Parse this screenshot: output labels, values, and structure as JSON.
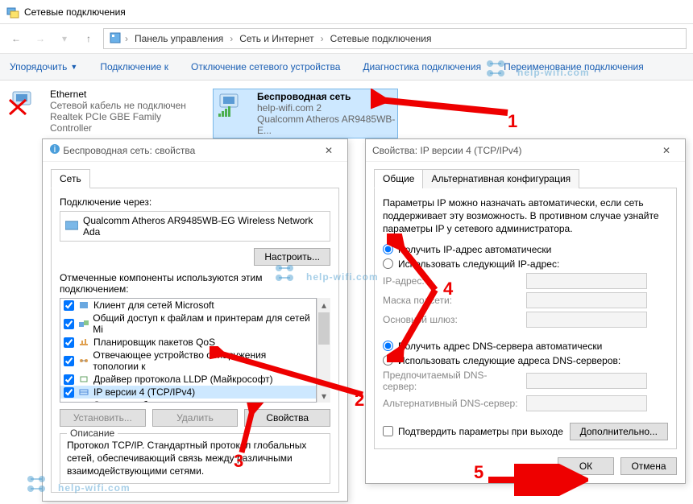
{
  "window": {
    "title": "Сетевые подключения"
  },
  "breadcrumb": {
    "p1": "Панель управления",
    "p2": "Сеть и Интернет",
    "p3": "Сетевые подключения"
  },
  "toolbar": {
    "organize": "Упорядочить",
    "connect": "Подключение к",
    "disable": "Отключение сетевого устройства",
    "diag": "Диагностика подключения",
    "rename": "Переименование подключения"
  },
  "net": {
    "eth": {
      "name": "Ethernet",
      "status": "Сетевой кабель не подключен",
      "device": "Realtek PCIe GBE Family Controller"
    },
    "wifi": {
      "name": "Беспроводная сеть",
      "status": "help-wifi.com  2",
      "device": "Qualcomm Atheros AR9485WB-E..."
    }
  },
  "dlg1": {
    "title": "Беспроводная сеть: свойства",
    "tab_net": "Сеть",
    "connect_via": "Подключение через:",
    "adapter": "Qualcomm Atheros AR9485WB-EG Wireless Network Ada",
    "configure": "Настроить...",
    "components_label": "Отмеченные компоненты используются этим подключением:",
    "items": [
      "Клиент для сетей Microsoft",
      "Общий доступ к файлам и принтерам для сетей Mi",
      "Планировщик пакетов QoS",
      "Отвечающее устройство обнаружения топологии к",
      "Драйвер протокола LLDP (Майкрософт)",
      "IP версии 4 (TCP/IPv4)",
      "Ответчик обнаружения топологии канального уров"
    ],
    "install": "Установить...",
    "remove": "Удалить",
    "props": "Свойства",
    "desc_title": "Описание",
    "desc": "Протокол TCP/IP. Стандартный протокол глобальных сетей, обеспечивающий связь между различными взаимодействующими сетями."
  },
  "dlg2": {
    "title": "Свойства: IP версии 4 (TCP/IPv4)",
    "tab_general": "Общие",
    "tab_alt": "Альтернативная конфигурация",
    "intro": "Параметры IP можно назначать автоматически, если сеть поддерживает эту возможность. В противном случае узнайте параметры IP у сетевого администратора.",
    "ip_auto": "Получить IP-адрес автоматически",
    "ip_manual": "Использовать следующий IP-адрес:",
    "ip_addr": "IP-адрес:",
    "mask": "Маска подсети:",
    "gateway": "Основной шлюз:",
    "dns_auto": "Получить адрес DNS-сервера автоматически",
    "dns_manual": "Использовать следующие адреса DNS-серверов:",
    "dns_pref": "Предпочитаемый DNS-сервер:",
    "dns_alt": "Альтернативный DNS-сервер:",
    "validate": "Подтвердить параметры при выходе",
    "advanced": "Дополнительно...",
    "ok": "ОК",
    "cancel": "Отмена"
  },
  "watermark": "help-wifi.com",
  "annotations": {
    "n1": "1",
    "n2": "2",
    "n3": "3",
    "n4": "4",
    "n5": "5"
  }
}
